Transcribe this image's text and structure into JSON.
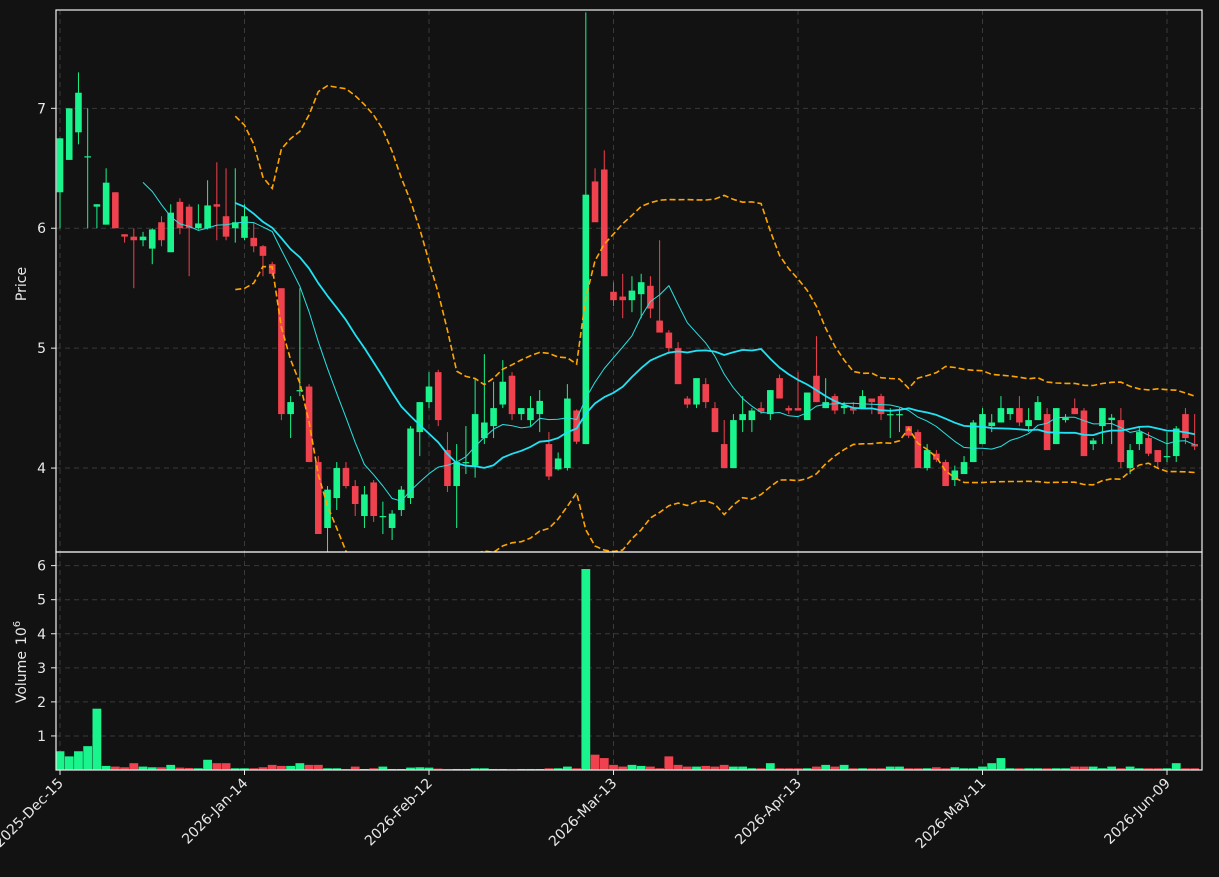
{
  "chart_data": {
    "type": "candlestick",
    "x_tick_labels": [
      "2025-Dec-15",
      "2026-Jan-14",
      "2026-Feb-12",
      "2026-Mar-13",
      "2026-Apr-13",
      "2026-May-11",
      "2026-Jun-09"
    ],
    "x_tick_indices": [
      0,
      20,
      40,
      60,
      80,
      100,
      120
    ],
    "price_panel": {
      "ylabel": "Price",
      "yticks": [
        4,
        5,
        6,
        7
      ],
      "ylim": [
        3.3,
        7.82
      ],
      "grid": true
    },
    "volume_panel": {
      "ylabel": "Volume",
      "ylabel_exponent": "10",
      "ylabel_exponent_power": "6",
      "yticks": [
        1,
        2,
        3,
        4,
        5,
        6
      ],
      "ylim": [
        0,
        6.4
      ],
      "unit_multiplier": 1000000,
      "grid": true
    },
    "colors": {
      "up": "#19f58c",
      "down": "#f0424e",
      "ma_fast": "#2ae0e0",
      "ma_slow": "#1fe3f5",
      "bands": "#ffa500",
      "background": "#121212",
      "grid": "#3a3a3a",
      "text": "#e8e8e8"
    },
    "candles": [
      [
        6.3,
        6.75,
        6.0,
        6.75,
        0.55
      ],
      [
        6.57,
        7.0,
        6.57,
        7.0,
        0.4
      ],
      [
        6.8,
        7.3,
        6.7,
        7.13,
        0.55
      ],
      [
        6.6,
        7.0,
        6.0,
        6.6,
        0.7
      ],
      [
        6.18,
        6.2,
        6.0,
        6.2,
        1.8
      ],
      [
        6.03,
        6.5,
        6.03,
        6.38,
        0.12
      ],
      [
        6.3,
        6.3,
        6.0,
        6.0,
        0.1
      ],
      [
        5.95,
        5.95,
        5.88,
        5.93,
        0.08
      ],
      [
        5.93,
        6.0,
        5.5,
        5.9,
        0.2
      ],
      [
        5.9,
        5.97,
        5.85,
        5.93,
        0.1
      ],
      [
        5.83,
        6.0,
        5.7,
        5.99,
        0.08
      ],
      [
        6.05,
        6.1,
        5.85,
        5.9,
        0.08
      ],
      [
        5.8,
        6.2,
        5.8,
        6.13,
        0.15
      ],
      [
        6.22,
        6.25,
        5.95,
        6.0,
        0.07
      ],
      [
        6.18,
        6.2,
        5.6,
        6.0,
        0.06
      ],
      [
        6.0,
        6.2,
        5.99,
        6.04,
        0.05
      ],
      [
        6.0,
        6.4,
        5.99,
        6.19,
        0.3
      ],
      [
        6.2,
        6.55,
        5.9,
        6.18,
        0.2
      ],
      [
        6.1,
        6.5,
        5.9,
        5.93,
        0.2
      ],
      [
        6.0,
        6.5,
        5.88,
        6.05,
        0.05
      ],
      [
        5.92,
        6.2,
        5.9,
        6.1,
        0.05
      ],
      [
        5.92,
        6.05,
        5.8,
        5.85,
        0.05
      ],
      [
        5.85,
        5.86,
        5.6,
        5.77,
        0.08
      ],
      [
        5.7,
        5.72,
        5.6,
        5.62,
        0.15
      ],
      [
        5.5,
        5.5,
        4.4,
        4.45,
        0.12
      ],
      [
        4.45,
        4.6,
        4.25,
        4.55,
        0.12
      ],
      [
        4.65,
        5.5,
        4.6,
        4.65,
        0.2
      ],
      [
        4.68,
        4.7,
        4.05,
        4.05,
        0.15
      ],
      [
        4.05,
        4.1,
        3.45,
        3.45,
        0.15
      ],
      [
        3.5,
        3.85,
        3.3,
        3.82,
        0.05
      ],
      [
        3.75,
        4.05,
        3.65,
        4.0,
        0.05
      ],
      [
        4.0,
        4.05,
        3.83,
        3.85,
        0.03
      ],
      [
        3.85,
        3.9,
        3.6,
        3.7,
        0.1
      ],
      [
        3.6,
        3.85,
        3.5,
        3.78,
        0.03
      ],
      [
        3.88,
        3.9,
        3.55,
        3.6,
        0.05
      ],
      [
        3.6,
        3.72,
        3.45,
        3.6,
        0.1
      ],
      [
        3.5,
        3.65,
        3.4,
        3.62,
        0.03
      ],
      [
        3.65,
        3.85,
        3.6,
        3.82,
        0.03
      ],
      [
        3.75,
        4.35,
        3.7,
        4.33,
        0.07
      ],
      [
        4.3,
        4.55,
        4.1,
        4.55,
        0.08
      ],
      [
        4.55,
        4.8,
        4.5,
        4.68,
        0.07
      ],
      [
        4.8,
        4.82,
        4.35,
        4.4,
        0.04
      ],
      [
        4.15,
        4.3,
        3.8,
        3.85,
        0.03
      ],
      [
        3.85,
        4.2,
        3.5,
        4.05,
        0.03
      ],
      [
        4.05,
        4.35,
        3.95,
        4.05,
        0.03
      ],
      [
        4.02,
        4.75,
        3.92,
        4.45,
        0.05
      ],
      [
        4.25,
        4.95,
        4.2,
        4.38,
        0.05
      ],
      [
        4.35,
        4.72,
        4.25,
        4.5,
        0.03
      ],
      [
        4.53,
        4.9,
        4.5,
        4.72,
        0.03
      ],
      [
        4.77,
        4.8,
        4.4,
        4.45,
        0.03
      ],
      [
        4.45,
        4.5,
        4.4,
        4.5,
        0.03
      ],
      [
        4.4,
        4.6,
        4.35,
        4.5,
        0.03
      ],
      [
        4.45,
        4.65,
        4.3,
        4.56,
        0.03
      ],
      [
        4.2,
        4.3,
        3.9,
        3.93,
        0.05
      ],
      [
        3.99,
        4.13,
        3.98,
        4.08,
        0.05
      ],
      [
        4.0,
        4.7,
        3.98,
        4.58,
        0.1
      ],
      [
        4.48,
        4.49,
        4.2,
        4.22,
        0.05
      ],
      [
        4.2,
        7.8,
        4.2,
        6.28,
        5.9
      ],
      [
        6.39,
        6.5,
        6.2,
        6.05,
        0.45
      ],
      [
        6.49,
        6.65,
        5.6,
        5.6,
        0.35
      ],
      [
        5.47,
        5.55,
        5.35,
        5.4,
        0.15
      ],
      [
        5.43,
        5.62,
        5.25,
        5.4,
        0.1
      ],
      [
        5.4,
        5.6,
        5.3,
        5.48,
        0.15
      ],
      [
        5.45,
        5.62,
        5.25,
        5.55,
        0.12
      ],
      [
        5.52,
        5.6,
        5.25,
        5.33,
        0.1
      ],
      [
        5.23,
        5.9,
        5.2,
        5.13,
        0.05
      ],
      [
        5.13,
        5.15,
        4.95,
        5.0,
        0.4
      ],
      [
        5.0,
        5.05,
        4.7,
        4.7,
        0.15
      ],
      [
        4.58,
        4.6,
        4.5,
        4.53,
        0.1
      ],
      [
        4.53,
        4.55,
        4.5,
        4.75,
        0.1
      ],
      [
        4.7,
        4.75,
        4.5,
        4.55,
        0.12
      ],
      [
        4.5,
        4.55,
        4.3,
        4.3,
        0.1
      ],
      [
        4.2,
        4.4,
        4.0,
        4.0,
        0.15
      ],
      [
        4.0,
        4.45,
        4.0,
        4.4,
        0.1
      ],
      [
        4.4,
        4.6,
        4.3,
        4.45,
        0.1
      ],
      [
        4.4,
        4.5,
        4.3,
        4.48,
        0.05
      ],
      [
        4.5,
        4.55,
        4.45,
        4.47,
        0.05
      ],
      [
        4.45,
        4.65,
        4.4,
        4.65,
        0.2
      ],
      [
        4.75,
        4.78,
        4.58,
        4.58,
        0.05
      ],
      [
        4.5,
        4.52,
        4.45,
        4.48,
        0.05
      ],
      [
        4.5,
        4.8,
        4.5,
        4.48,
        0.05
      ],
      [
        4.4,
        4.63,
        4.4,
        4.63,
        0.05
      ],
      [
        4.77,
        5.1,
        4.55,
        4.55,
        0.1
      ],
      [
        4.5,
        4.75,
        4.5,
        4.55,
        0.15
      ],
      [
        4.6,
        4.62,
        4.45,
        4.48,
        0.1
      ],
      [
        4.5,
        4.55,
        4.45,
        4.52,
        0.15
      ],
      [
        4.5,
        4.55,
        4.45,
        4.48,
        0.05
      ],
      [
        4.5,
        4.65,
        4.5,
        4.6,
        0.05
      ],
      [
        4.58,
        4.58,
        4.45,
        4.55,
        0.05
      ],
      [
        4.6,
        4.62,
        4.4,
        4.45,
        0.05
      ],
      [
        4.45,
        4.5,
        4.25,
        4.45,
        0.1
      ],
      [
        4.45,
        4.5,
        4.3,
        4.45,
        0.1
      ],
      [
        4.35,
        4.35,
        4.25,
        4.27,
        0.05
      ],
      [
        4.3,
        4.32,
        4.0,
        4.0,
        0.05
      ],
      [
        4.0,
        4.2,
        3.98,
        4.15,
        0.05
      ],
      [
        4.12,
        4.15,
        4.05,
        4.07,
        0.08
      ],
      [
        4.05,
        4.07,
        3.85,
        3.85,
        0.05
      ],
      [
        3.9,
        4.02,
        3.85,
        3.98,
        0.08
      ],
      [
        3.95,
        4.1,
        3.95,
        4.05,
        0.05
      ],
      [
        4.05,
        4.4,
        4.05,
        4.38,
        0.05
      ],
      [
        4.2,
        4.5,
        4.2,
        4.45,
        0.1
      ],
      [
        4.35,
        4.45,
        4.3,
        4.38,
        0.2
      ],
      [
        4.38,
        4.6,
        4.38,
        4.5,
        0.35
      ],
      [
        4.45,
        4.5,
        4.4,
        4.5,
        0.05
      ],
      [
        4.5,
        4.6,
        4.35,
        4.38,
        0.05
      ],
      [
        4.35,
        4.5,
        4.3,
        4.4,
        0.05
      ],
      [
        4.4,
        4.6,
        4.4,
        4.55,
        0.05
      ],
      [
        4.45,
        4.5,
        4.15,
        4.15,
        0.05
      ],
      [
        4.2,
        4.5,
        4.2,
        4.5,
        0.05
      ],
      [
        4.4,
        4.45,
        4.38,
        4.42,
        0.05
      ],
      [
        4.5,
        4.58,
        4.45,
        4.45,
        0.1
      ],
      [
        4.48,
        4.5,
        4.1,
        4.1,
        0.1
      ],
      [
        4.2,
        4.25,
        4.15,
        4.23,
        0.1
      ],
      [
        4.35,
        4.5,
        4.2,
        4.5,
        0.05
      ],
      [
        4.4,
        4.45,
        4.2,
        4.42,
        0.1
      ],
      [
        4.4,
        4.5,
        4.0,
        4.05,
        0.05
      ],
      [
        4.0,
        4.2,
        3.95,
        4.15,
        0.1
      ],
      [
        4.2,
        4.35,
        4.15,
        4.3,
        0.05
      ],
      [
        4.25,
        4.3,
        4.1,
        4.12,
        0.05
      ],
      [
        4.15,
        4.15,
        4.0,
        4.05,
        0.05
      ],
      [
        4.1,
        4.3,
        4.05,
        4.1,
        0.05
      ],
      [
        4.1,
        4.35,
        4.05,
        4.33,
        0.2
      ],
      [
        4.45,
        4.5,
        4.2,
        4.25,
        0.05
      ],
      [
        4.2,
        4.45,
        4.15,
        4.18,
        0.05
      ]
    ],
    "overlays": [
      {
        "kind": "moving_average",
        "period": 10,
        "style": "thin",
        "color_key": "ma_fast"
      },
      {
        "kind": "moving_average",
        "period": 20,
        "style": "thick",
        "color_key": "ma_slow"
      },
      {
        "kind": "bollinger_bands",
        "period": 20,
        "std": 2,
        "style": "dashed",
        "color_key": "bands"
      }
    ]
  }
}
